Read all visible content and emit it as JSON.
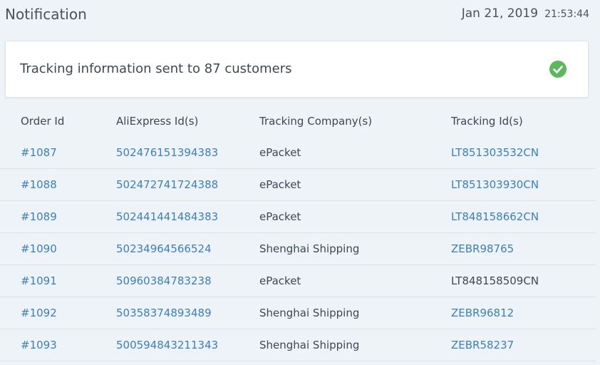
{
  "header": {
    "title": "Notification",
    "date": "Jan 21, 2019",
    "time": "21:53:44"
  },
  "card": {
    "message_prefix": "Tracking information sent to ",
    "count": "87",
    "message_suffix": " customers",
    "status_icon": "check-circle-icon",
    "status_color": "#5cb85c"
  },
  "table": {
    "headers": [
      "Order Id",
      "AliExpress Id(s)",
      "Tracking Company(s)",
      "Tracking Id(s)"
    ],
    "rows": [
      {
        "order": "#1087",
        "ali": "502476151394383",
        "company": "ePacket",
        "tracking": "LT851303532CN",
        "tracking_link": true
      },
      {
        "order": "#1088",
        "ali": "502472741724388",
        "company": "ePacket",
        "tracking": "LT851303930CN",
        "tracking_link": true
      },
      {
        "order": "#1089",
        "ali": "502441441484383",
        "company": "ePacket",
        "tracking": "LT848158662CN",
        "tracking_link": true
      },
      {
        "order": "#1090",
        "ali": "50234964566524",
        "company": "Shenghai Shipping",
        "tracking": "ZEBR98765",
        "tracking_link": true
      },
      {
        "order": "#1091",
        "ali": "50960384783238",
        "company": "ePacket",
        "tracking": "LT848158509CN",
        "tracking_link": false
      },
      {
        "order": "#1092",
        "ali": "50358374893489",
        "company": "Shenghai Shipping",
        "tracking": "ZEBR96812",
        "tracking_link": true
      },
      {
        "order": "#1093",
        "ali": "500594843211343",
        "company": "Shenghai Shipping",
        "tracking": "ZEBR58237",
        "tracking_link": true
      }
    ]
  },
  "colors": {
    "link": "#3a7fc1",
    "background": "#edf3f7",
    "text": "#3d4853"
  }
}
